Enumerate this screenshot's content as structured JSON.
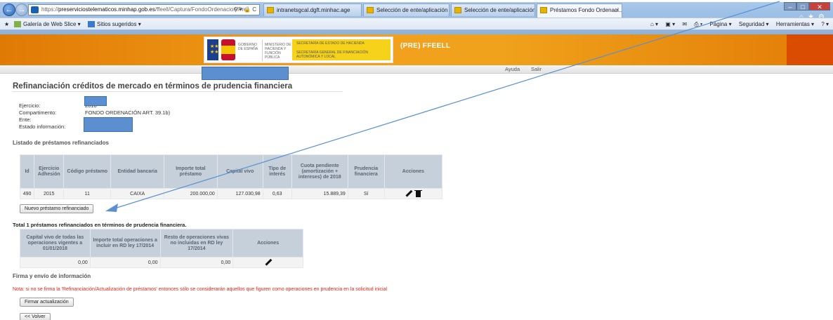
{
  "browser": {
    "url_prefix": "https://",
    "url_host": "preserviciostelematicos.minhap.gob.es",
    "url_path": "/ffeell/Captura/FondoOrdenacion/Prer",
    "tabs": [
      {
        "label": "intranetsgcal.dgft.minhac.age"
      },
      {
        "label": "Selección de ente/aplicación - ..."
      },
      {
        "label": "Selección de ente/aplicación - ..."
      },
      {
        "label": "Préstamos Fondo Ordenaci..."
      }
    ],
    "favorites": [
      "Galería de Web Slice ▾",
      "Sitios sugeridos ▾"
    ],
    "commands": [
      "Página ▾",
      "Seguridad ▾",
      "Herramientas ▾"
    ]
  },
  "banner": {
    "site_title": "(PRE) FFEELL",
    "logo_gov": "Gobierno de España",
    "logo_ministry": "Ministerio de Hacienda y Función Pública",
    "logo_secretaria": "Secretaría de Estado de Hacienda",
    "logo_secretaria_2": "Secretaría General de Financiación Autonómica y Local"
  },
  "menu": {
    "help": "Ayuda",
    "exit": "Salir"
  },
  "page": {
    "title": "Refinanciación créditos de mercado en términos de prudencia financiera",
    "info": {
      "ejercicio_label": "Ejercicio:",
      "ejercicio_value": "2018",
      "compartimento_label": "Compartimento:",
      "compartimento_value": "FONDO ORDENACIÓN ART. 39.1b)",
      "ente_label": "Ente:",
      "estado_label": "Estado información:"
    },
    "list_section_title": "Listado de préstamos refinanciados",
    "loans_table": {
      "headers": [
        "Id",
        "Ejercicio Adhesión",
        "Código préstamo",
        "Entidad bancaria",
        "Importe total préstamo",
        "Capital vivo",
        "Tipo de interés",
        "Cuota pendiente (amortización + intereses) de 2018",
        "Prudencia financiera",
        "Acciones"
      ],
      "rows": [
        [
          "490",
          "2015",
          "11",
          "CAIXA",
          "200.000,00",
          "127.030,98",
          "0,63",
          "15.889,39",
          "Sí"
        ]
      ]
    },
    "new_loan_button": "Nuevo préstamo refinanciado",
    "total_text": "Total 1 préstamos refinanciados en términos de prudencia financiera.",
    "summary_table": {
      "headers": [
        "Capital vivo de todas las operaciones vigentes a 01/01/2018",
        "Importe total operaciones a incluir en RD ley 17/2014",
        "Resto de operaciones vivas no incluidas en RD ley 17/2014",
        "Acciones"
      ],
      "row": [
        "0,00",
        "0,00",
        "0,00"
      ]
    },
    "sign_section_title": "Firma y envío de información",
    "note": "Nota: si no se firma la 'Refinanciación/Actualización de préstamos' entonces sólo se considerarán aquellos que figuren como operaciones en prudencia en la solicitud inicial",
    "sign_button": "Firmar actualización",
    "back_button": "<< Volver"
  },
  "colors": {
    "arrow": "#5b8fd0",
    "banner": "#f0a21c",
    "note": "#e0261b"
  }
}
